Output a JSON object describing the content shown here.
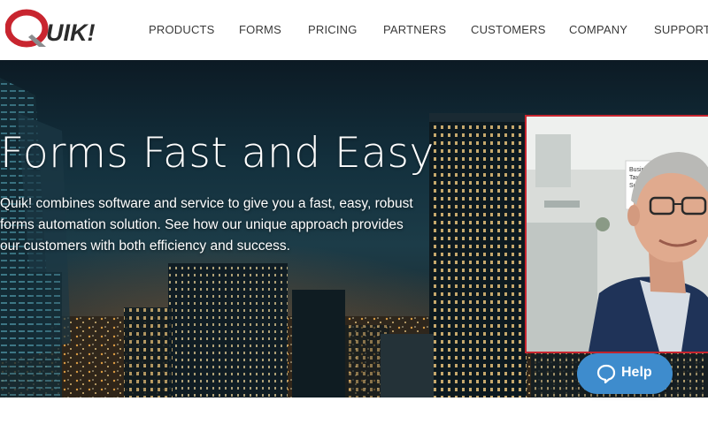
{
  "brand": {
    "logo_text": "QUIK!",
    "primary_color": "#c8252f",
    "dark_color": "#2b2b2b"
  },
  "nav": {
    "items": [
      {
        "label": "PRODUCTS"
      },
      {
        "label": "FORMS"
      },
      {
        "label": "PRICING"
      },
      {
        "label": "PARTNERS"
      },
      {
        "label": "CUSTOMERS"
      },
      {
        "label": "COMPANY"
      },
      {
        "label": "SUPPORT"
      }
    ]
  },
  "hero": {
    "title": "Forms Fast and Easy",
    "description": "Quik! combines software and service to give you a fast, easy, robust forms automation solution. See how our unique approach provides our customers  with both efficiency and success.",
    "video_border_color": "#c8252f"
  },
  "help": {
    "label": "Help",
    "icon": "chat-bubble-icon",
    "color": "#3e8ccd"
  }
}
